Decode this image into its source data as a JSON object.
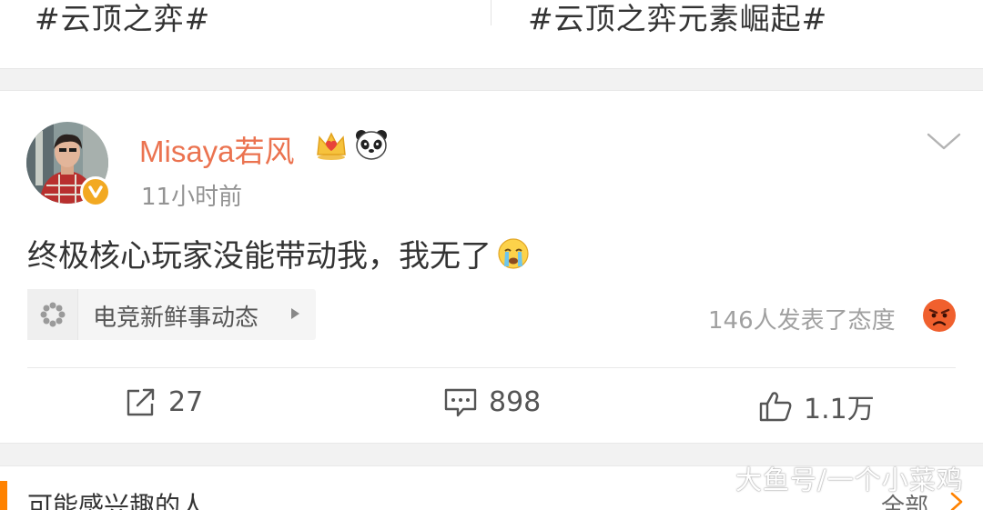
{
  "topics": {
    "left": "#云顶之弈#",
    "right": "#云顶之弈元素崛起#"
  },
  "post": {
    "user_name": "Misaya若风",
    "time": "11小时前",
    "text": "终极核心玩家没能带动我，我无了",
    "tag_label": "电竞新鲜事动态",
    "attitude_text": "146人发表了态度",
    "actions": {
      "repost_count": "27",
      "comment_count": "898",
      "like_count": "1.1万"
    }
  },
  "recommend": {
    "title": "可能感兴趣的人",
    "see_all": "全部"
  },
  "watermark": "大鱼号/一个小菜鸡",
  "colors": {
    "username": "#eb7350",
    "accent": "#ff8200",
    "verify_badge": "#f2a922"
  },
  "icons": [
    "crown-icon",
    "panda-icon",
    "chevron-down-icon",
    "crying-emoji-icon",
    "spinner-icon",
    "angry-emoji-icon",
    "repost-icon",
    "comment-icon",
    "like-icon",
    "chevron-right-icon"
  ]
}
